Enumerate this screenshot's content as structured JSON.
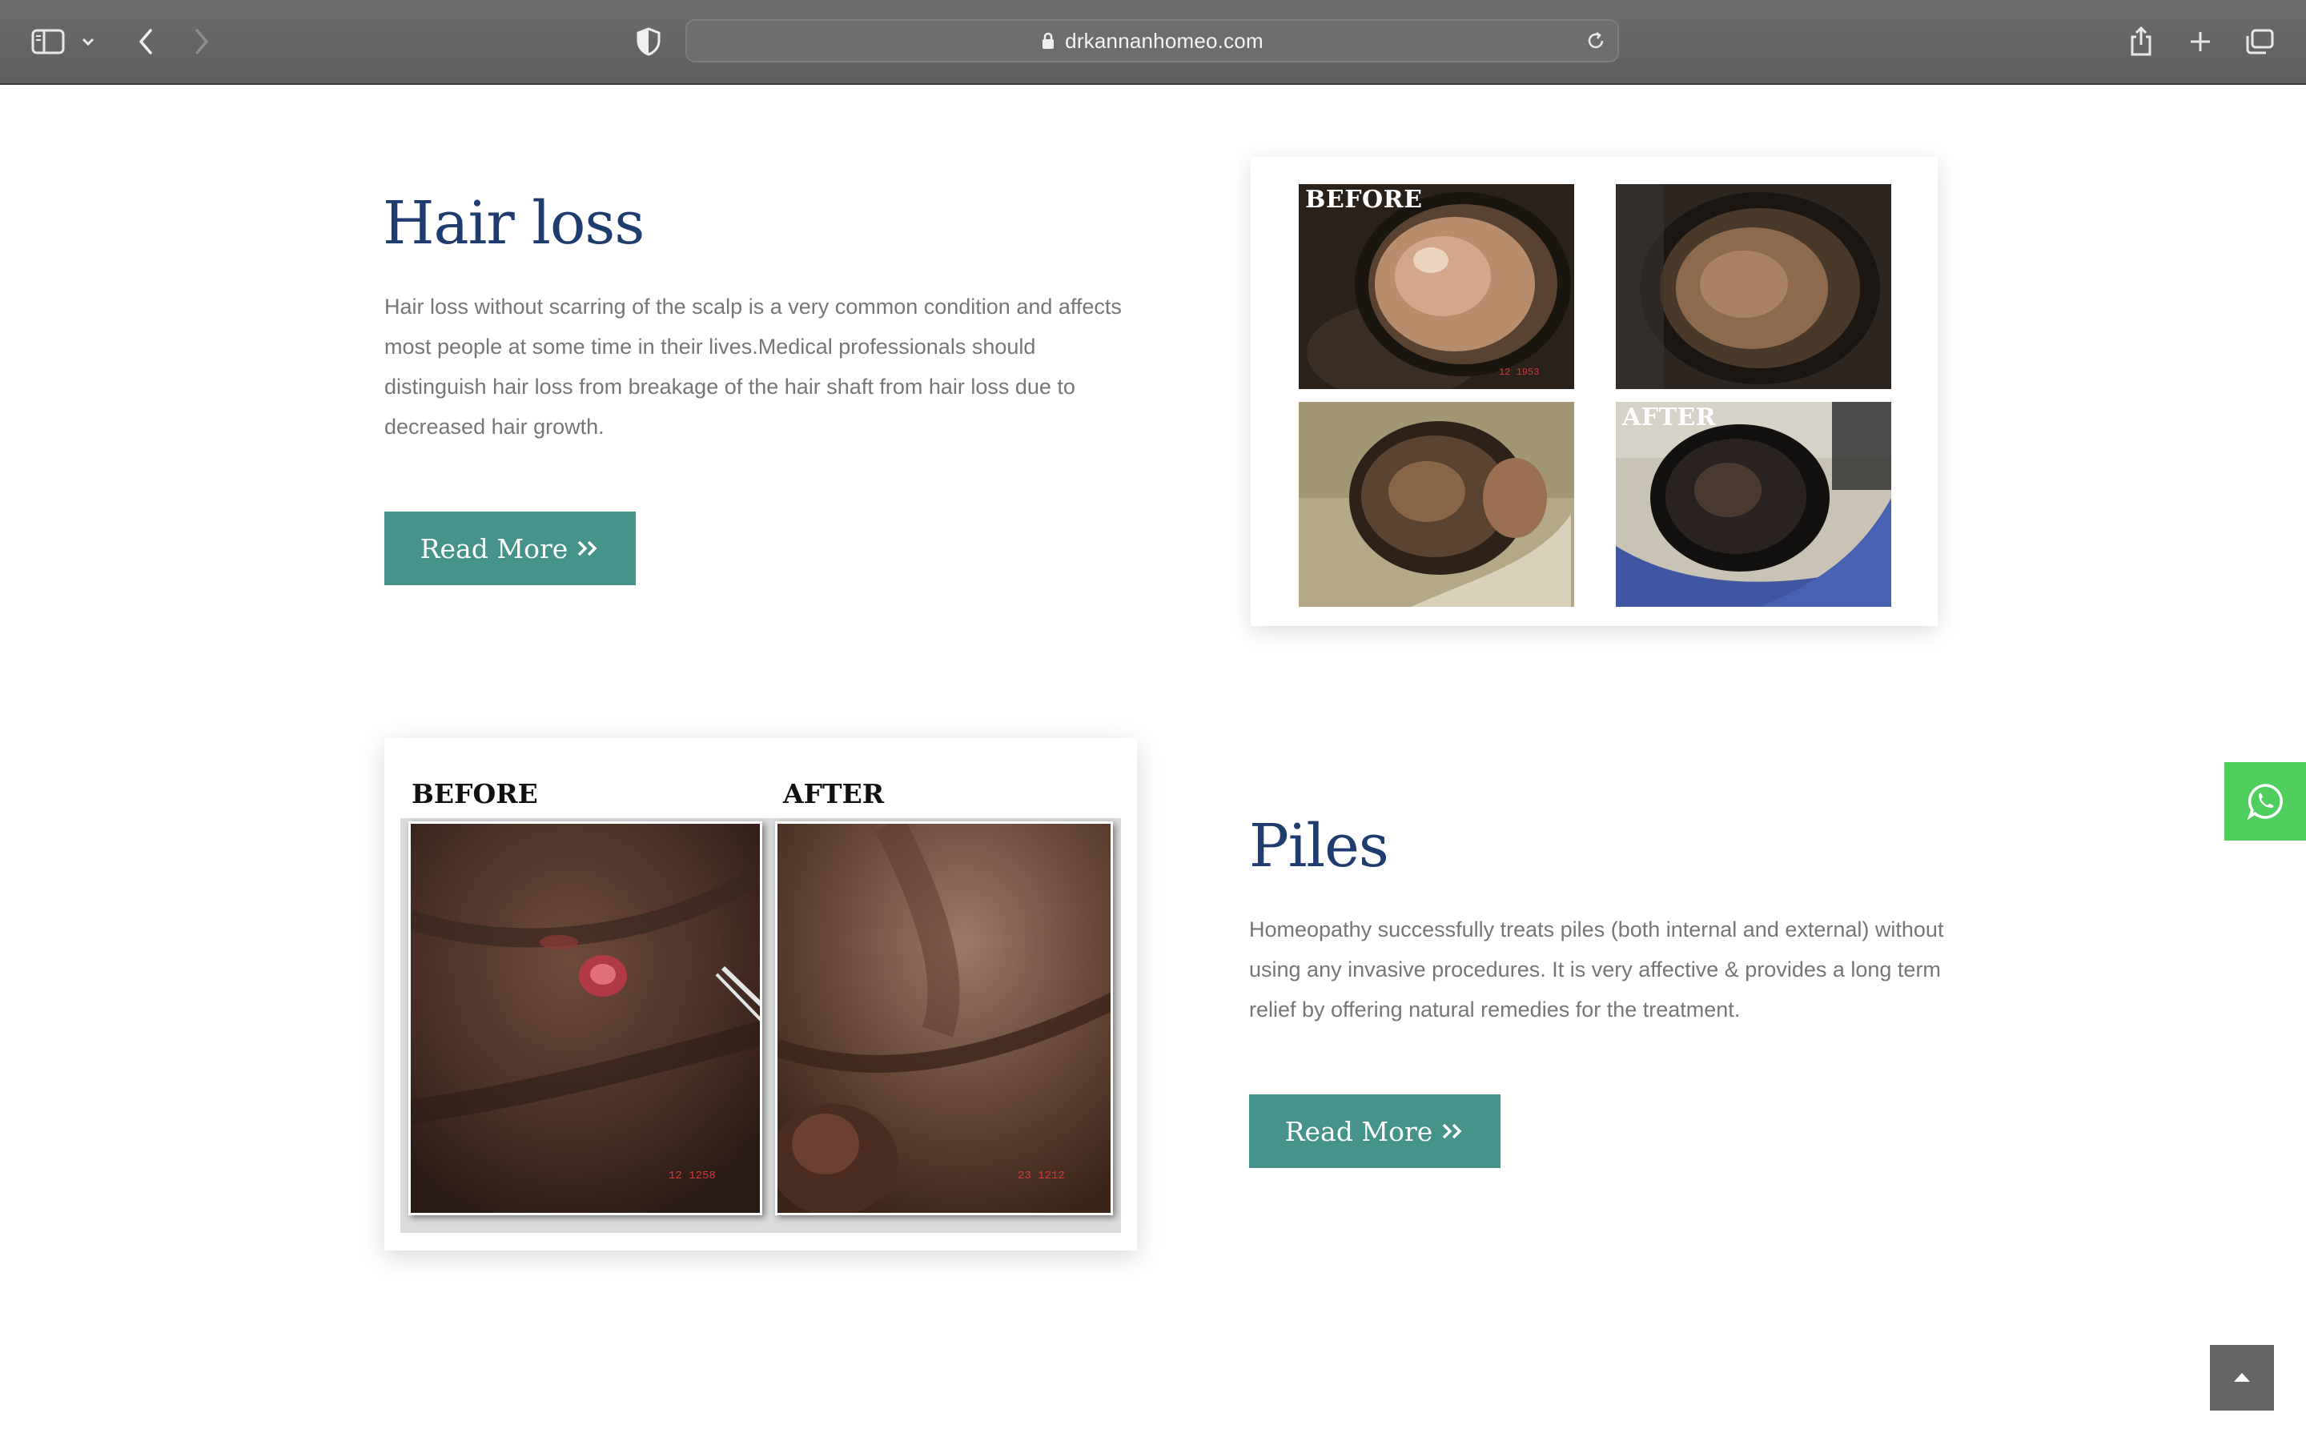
{
  "browser": {
    "url": "drkannanhomeo.com"
  },
  "hair_loss": {
    "title": "Hair loss",
    "description": "Hair loss without scarring of the scalp is a very common condition and affects most people at some time in their lives.Medical professionals should distinguish hair loss from breakage of the hair shaft from hair loss due to decreased hair growth.",
    "read_more": "Read More",
    "photos": {
      "before_label": "BEFORE",
      "after_label": "AFTER"
    }
  },
  "piles": {
    "title": "Piles",
    "description": "Homeopathy successfully treats piles (both internal and external) without using any invasive procedures. It is very affective & provides a long term relief by offering natural remedies for the treatment.",
    "read_more": "Read More",
    "photos": {
      "before_label": "BEFORE",
      "after_label": "AFTER"
    }
  },
  "icons": {
    "sidebar": "sidebar-icon",
    "back": "chevron-left-icon",
    "forward": "chevron-right-icon",
    "shield": "shield-icon",
    "lock": "lock-icon",
    "reload": "reload-icon",
    "share": "share-icon",
    "new_tab": "plus-icon",
    "tabs": "tabs-overview-icon",
    "whatsapp": "whatsapp-icon",
    "scroll_top": "chevron-up-icon"
  },
  "colors": {
    "heading": "#1f3c6f",
    "button": "#45938a",
    "whatsapp": "#4fce5d",
    "body_text": "#767676"
  }
}
